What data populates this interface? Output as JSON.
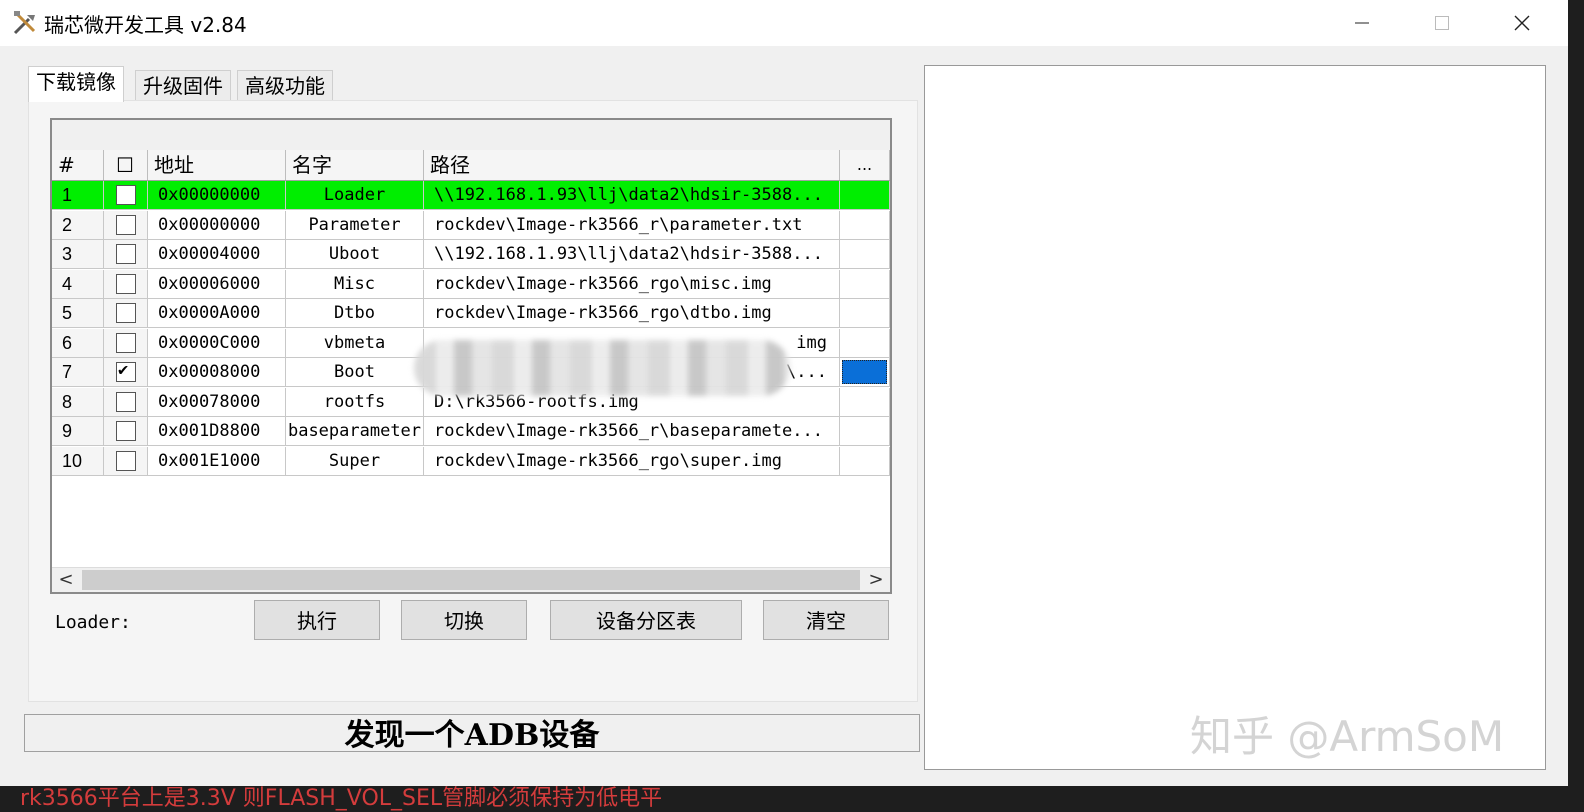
{
  "window": {
    "title": "瑞芯微开发工具 v2.84",
    "icon": "tools-icon"
  },
  "tabs": [
    {
      "label": "下载镜像",
      "active": true
    },
    {
      "label": "升级固件",
      "active": false
    },
    {
      "label": "高级功能",
      "active": false
    }
  ],
  "table": {
    "headers": {
      "num": "#",
      "check": "☐",
      "address": "地址",
      "name": "名字",
      "path": "路径",
      "more": "..."
    },
    "rows": [
      {
        "num": "1",
        "checked": false,
        "address": "0x00000000",
        "name": "Loader",
        "path": "\\\\192.168.1.93\\llj\\data2\\hdsir-3588...",
        "highlight": true
      },
      {
        "num": "2",
        "checked": false,
        "address": "0x00000000",
        "name": "Parameter",
        "path": "rockdev\\Image-rk3566_r\\parameter.txt"
      },
      {
        "num": "3",
        "checked": false,
        "address": "0x00004000",
        "name": "Uboot",
        "path": "\\\\192.168.1.93\\llj\\data2\\hdsir-3588..."
      },
      {
        "num": "4",
        "checked": false,
        "address": "0x00006000",
        "name": "Misc",
        "path": "rockdev\\Image-rk3566_rgo\\misc.img"
      },
      {
        "num": "5",
        "checked": false,
        "address": "0x0000A000",
        "name": "Dtbo",
        "path": "rockdev\\Image-rk3566_rgo\\dtbo.img"
      },
      {
        "num": "6",
        "checked": false,
        "address": "0x0000C000",
        "name": "vbmeta",
        "path": "img"
      },
      {
        "num": "7",
        "checked": true,
        "address": "0x00008000",
        "name": "Boot",
        "path": "\\...",
        "selected_more": true
      },
      {
        "num": "8",
        "checked": false,
        "address": "0x00078000",
        "name": "rootfs",
        "path": "D:\\rk3566-rootfs.img"
      },
      {
        "num": "9",
        "checked": false,
        "address": "0x001D8800",
        "name": "baseparameter",
        "path": "rockdev\\Image-rk3566_r\\baseparamete..."
      },
      {
        "num": "10",
        "checked": false,
        "address": "0x001E1000",
        "name": "Super",
        "path": "rockdev\\Image-rk3566_rgo\\super.img"
      }
    ]
  },
  "scroll": {
    "left": "<",
    "right": ">"
  },
  "loader_label": "Loader:",
  "buttons": {
    "execute": "执行",
    "switch": "切换",
    "partition": "设备分区表",
    "clear": "清空"
  },
  "status": "发现一个ADB设备",
  "watermark": "知乎 @ArmSoM",
  "bottom_text": "rk3566平台上是3.3V 则FLASH_VOL_SEL管脚必须保持为低电平",
  "colors": {
    "highlight": "#00ee00",
    "selected": "#0a6fd8"
  }
}
